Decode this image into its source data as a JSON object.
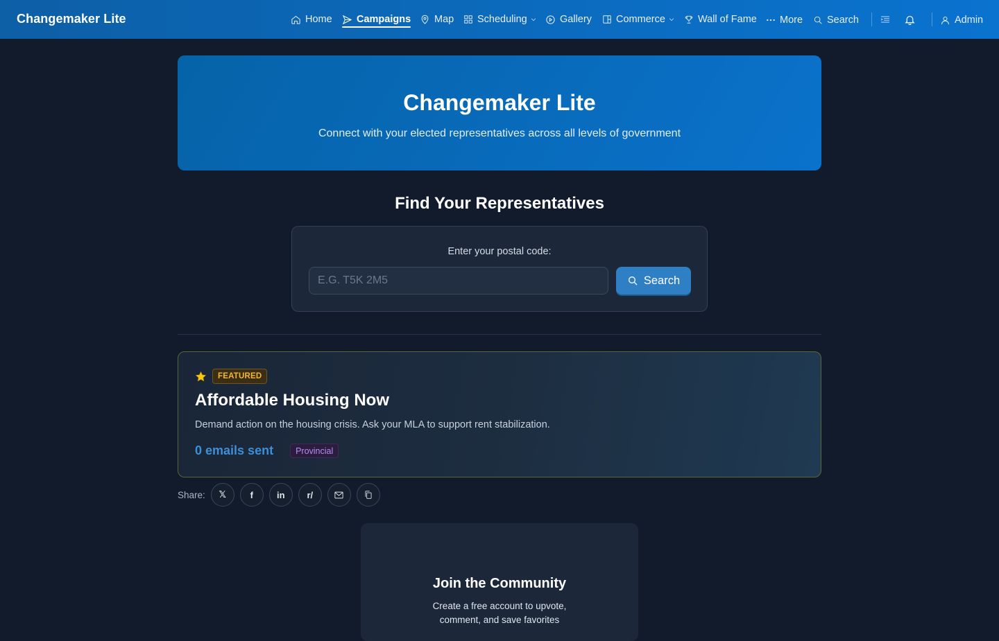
{
  "nav": {
    "brand": "Changemaker Lite",
    "items": [
      {
        "label": "Home",
        "icon": "home-icon"
      },
      {
        "label": "Campaigns",
        "icon": "send-icon",
        "active": true
      },
      {
        "label": "Map",
        "icon": "map-pin-icon"
      },
      {
        "label": "Scheduling",
        "icon": "grid-icon",
        "dropdown": true
      },
      {
        "label": "Gallery",
        "icon": "play-circle-icon"
      },
      {
        "label": "Commerce",
        "icon": "store-icon",
        "dropdown": true
      },
      {
        "label": "Wall of Fame",
        "icon": "trophy-icon"
      },
      {
        "label": "More",
        "icon": "ellipsis-icon"
      },
      {
        "label": "Search",
        "icon": "search-icon"
      }
    ],
    "user_label": "Admin"
  },
  "hero": {
    "title": "Changemaker Lite",
    "subtitle": "Connect with your elected representatives across all levels of government"
  },
  "find_reps": {
    "title": "Find Your Representatives",
    "label": "Enter your postal code:",
    "placeholder": "E.G. T5K 2M5",
    "value": "",
    "button_label": "Search"
  },
  "campaign": {
    "badge": "FEATURED",
    "title": "Affordable Housing Now",
    "description": "Demand action on the housing crisis. Ask your MLA to support rent stabilization.",
    "emails_sent": "0 emails sent",
    "level": "Provincial",
    "colors": {
      "badge": "#f1b73a",
      "emails": "#3d8fd6",
      "level": "#b98cf0"
    }
  },
  "share": {
    "label": "Share:",
    "buttons": [
      {
        "label": "𝕏",
        "icon": "x-icon"
      },
      {
        "label": "f",
        "icon": "facebook-icon"
      },
      {
        "label": "in",
        "icon": "linkedin-icon"
      },
      {
        "label": "r/",
        "icon": "reddit-icon"
      },
      {
        "label": "",
        "icon": "email-icon"
      },
      {
        "label": "",
        "icon": "copy-icon"
      }
    ]
  },
  "join": {
    "title": "Join the Community",
    "text": "Create a free account to upvote, comment, and save favorites"
  },
  "colors": {
    "nav_bg": "#0b6cc0",
    "page_bg": "#111b2b",
    "accent": "#2f7fc4"
  }
}
